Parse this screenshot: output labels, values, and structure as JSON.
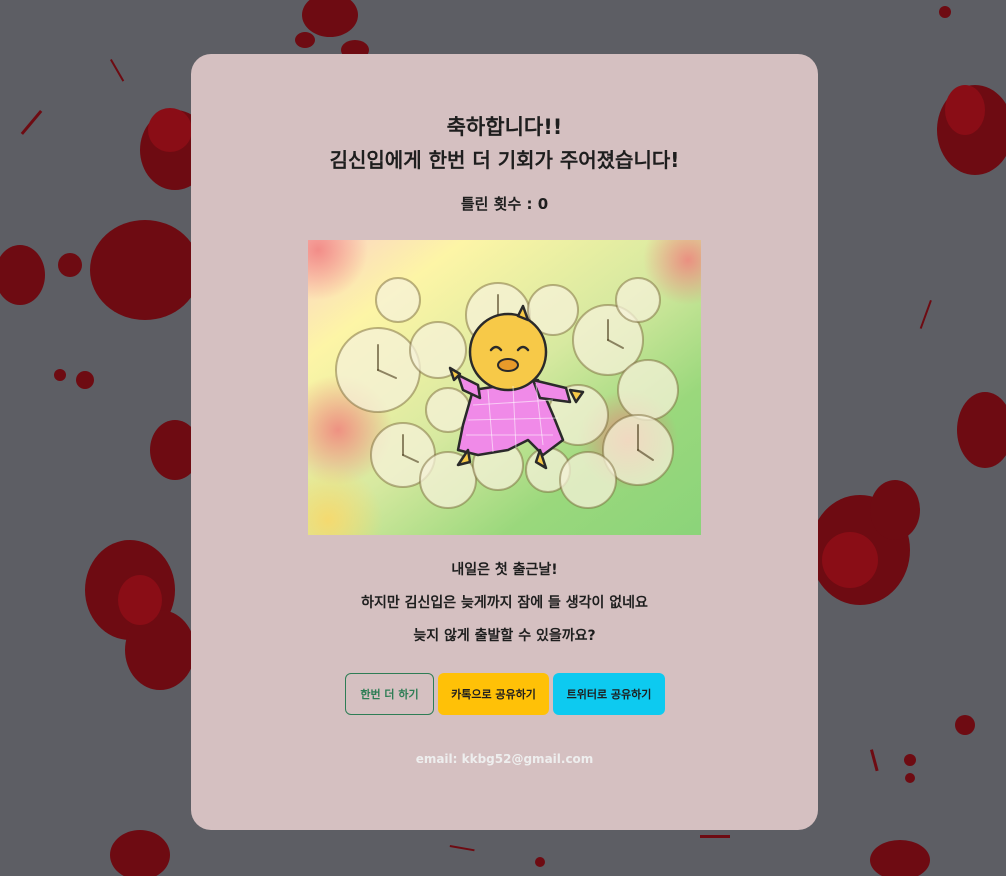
{
  "page": {
    "background_color": "#5d5e64",
    "splatter_color": "#7a0a12"
  },
  "card": {
    "background_color": "#d5c0c1",
    "title_line1": "축하합니다!!",
    "title_line2": "김신입에게 한번 더 기회가 주어졌습니다!",
    "wrong_count": "틀린 횟수 : 0",
    "illustration": {
      "subject": "yellow chick in pink pajamas floating among clocks"
    },
    "story": [
      "내일은 첫 출근날!",
      "하지만 김신입은 늦게까지 잠에 들 생각이 없네요",
      "늦지 않게 출발할 수 있을까요?"
    ],
    "buttons": {
      "retry": "한번 더 하기",
      "kakao": "카톡으로 공유하기",
      "twitter": "트위터로 공유하기"
    },
    "footer_email": "email: kkbg52@gmail.com"
  },
  "colors": {
    "retry_border": "#2e7d55",
    "kakao": "#ffc107",
    "twitter": "#0dcaf0"
  }
}
